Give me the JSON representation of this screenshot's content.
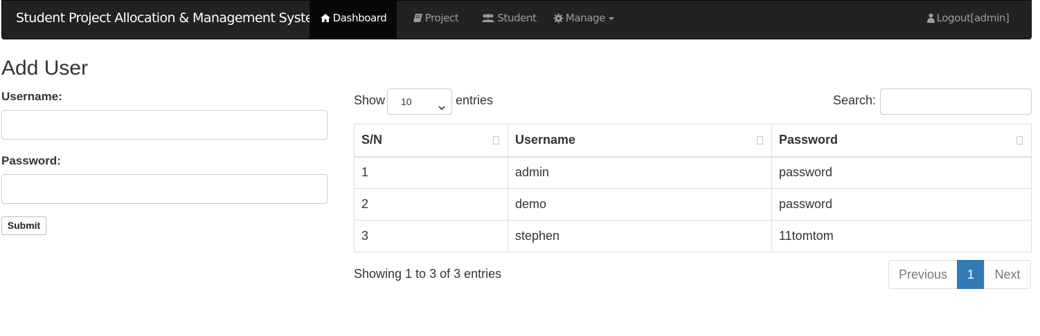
{
  "navbar": {
    "brand": "Student Project Allocation & Management System",
    "items": [
      {
        "label": "Dashboard",
        "icon": "home-icon",
        "active": true
      },
      {
        "label": "Project",
        "icon": "book-icon",
        "active": false
      },
      {
        "label": "Student",
        "icon": "users-icon",
        "active": false
      },
      {
        "label": "Manage",
        "icon": "gear-icon",
        "active": false
      }
    ],
    "logout_label": "Logout[admin]",
    "colors": {
      "background": "#222222",
      "active": "#080808",
      "text": "#9d9d9d"
    }
  },
  "form": {
    "title": "Add User",
    "username_label": "Username:",
    "username_value": "",
    "password_label": "Password:",
    "password_value": "",
    "submit_label": "Submit"
  },
  "table_controls": {
    "show_label": "Show",
    "length_value": "10",
    "entries_label": "entries",
    "search_label": "Search:",
    "search_value": ""
  },
  "table": {
    "columns": [
      "S/N",
      "Username",
      "Password"
    ],
    "rows": [
      [
        "1",
        "admin",
        "password"
      ],
      [
        "2",
        "demo",
        "password"
      ],
      [
        "3",
        "stephen",
        "11tomtom"
      ]
    ]
  },
  "footer": {
    "info": "Showing 1 to 3 of 3 entries",
    "prev_label": "Previous",
    "current_page": "1",
    "next_label": "Next",
    "accent_color": "#337ab7"
  }
}
